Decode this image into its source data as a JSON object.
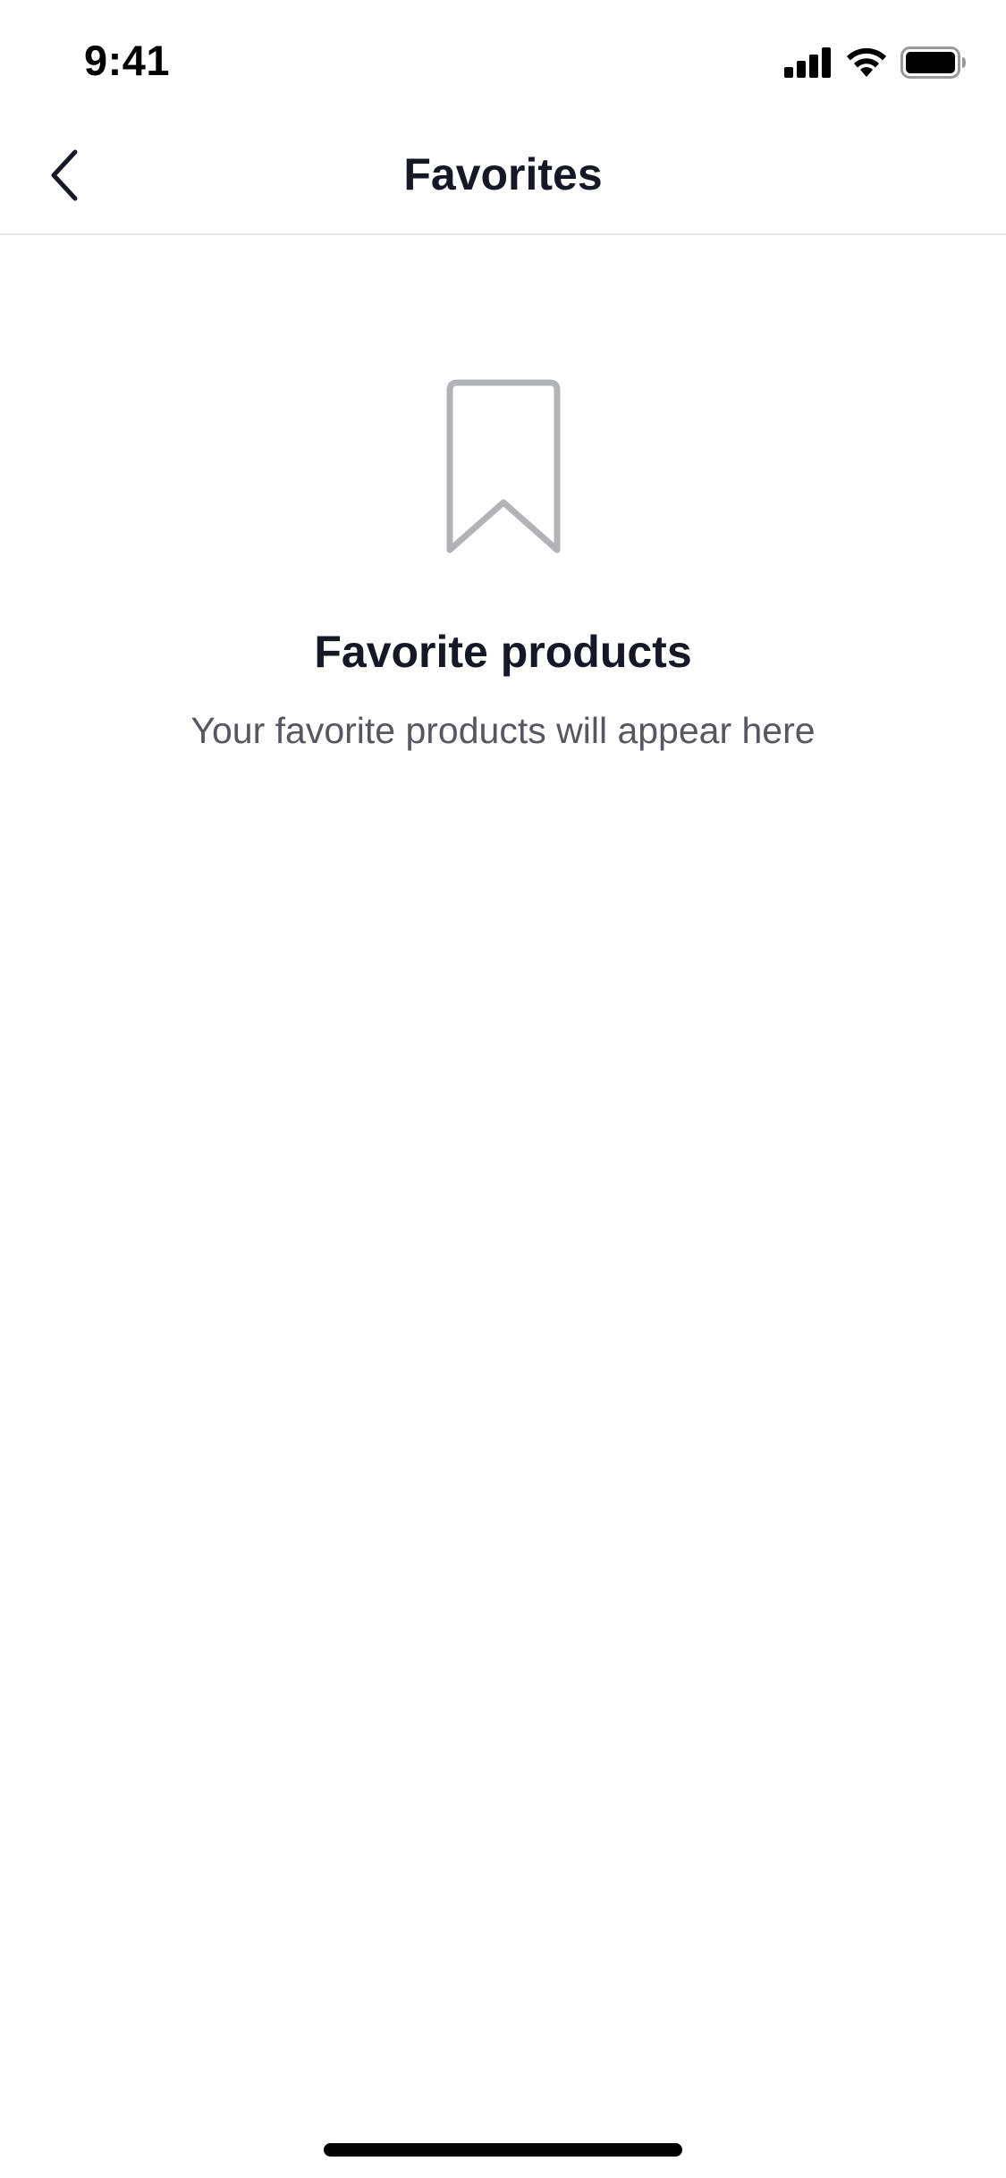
{
  "status_bar": {
    "time": "9:41",
    "icons": [
      "cellular-signal-icon",
      "wifi-icon",
      "battery-icon"
    ]
  },
  "nav": {
    "back_icon": "chevron-left-icon",
    "title": "Favorites"
  },
  "empty_state": {
    "icon": "bookmark-icon",
    "title": "Favorite products",
    "subtitle": "Your favorite products will appear here"
  },
  "colors": {
    "text_primary": "#161823",
    "text_secondary": "#57585f",
    "icon_gray": "#b2b3b7",
    "divider": "#e8e8ea",
    "background": "#ffffff"
  }
}
